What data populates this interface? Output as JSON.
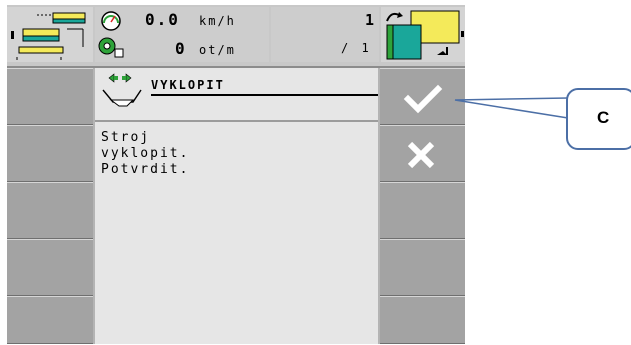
{
  "status": {
    "speed_value": "0.0",
    "speed_unit": "km/h",
    "rpm_value": "0",
    "rpm_unit": "ot/m",
    "gear_top": "1",
    "gear_bottom": "/ 1"
  },
  "dialog": {
    "title": "VYKLOPIT",
    "message": "Stroj\nvyklopit.\nPotvrdit."
  },
  "softkeys": {
    "confirm_icon": "check-icon",
    "cancel_icon": "cross-icon"
  },
  "annotation": {
    "callout_label": "C"
  },
  "colors": {
    "terminal_bg": "#b4b4b4",
    "content_bg": "#e6e6e6",
    "callout_border": "#4c6fa6",
    "icon_green": "#2ea33a",
    "icon_yellow": "#f4ea5a",
    "icon_teal": "#1aa79a"
  }
}
